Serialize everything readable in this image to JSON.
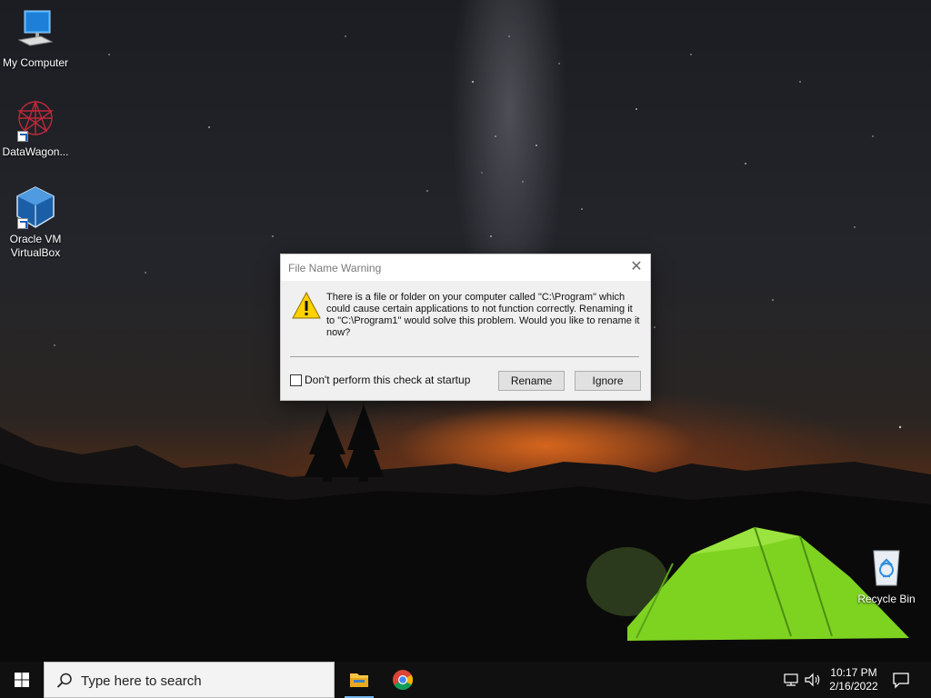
{
  "desktop": {
    "icons": [
      {
        "label": "My Computer",
        "icon": "computer-icon"
      },
      {
        "label": "DataWagon...",
        "icon": "datawagon-icon"
      },
      {
        "label": "Oracle VM VirtualBox",
        "icon": "virtualbox-icon"
      },
      {
        "label": "Recycle Bin",
        "icon": "recycle-bin-icon"
      }
    ]
  },
  "dialog": {
    "title": "File Name Warning",
    "close_glyph": "✕",
    "message": "There is a file or folder on your computer called \"C:\\Program\" which could cause certain applications to not function correctly.  Renaming it to \"C:\\Program1\" would solve this problem.  Would you like to rename it now?",
    "checkbox_label": "Don't perform this check at startup",
    "checkbox_checked": false,
    "buttons": {
      "rename": "Rename",
      "ignore": "Ignore"
    }
  },
  "taskbar": {
    "search_placeholder": "Type here to search",
    "apps": [
      "file-explorer-icon",
      "chrome-icon"
    ],
    "clock": {
      "time": "10:17 PM",
      "date": "2/16/2022"
    }
  },
  "colors": {
    "taskbar": "#101010",
    "accent": "#76b9ed",
    "tent": "#7ed321",
    "warning": "#ffd200"
  }
}
